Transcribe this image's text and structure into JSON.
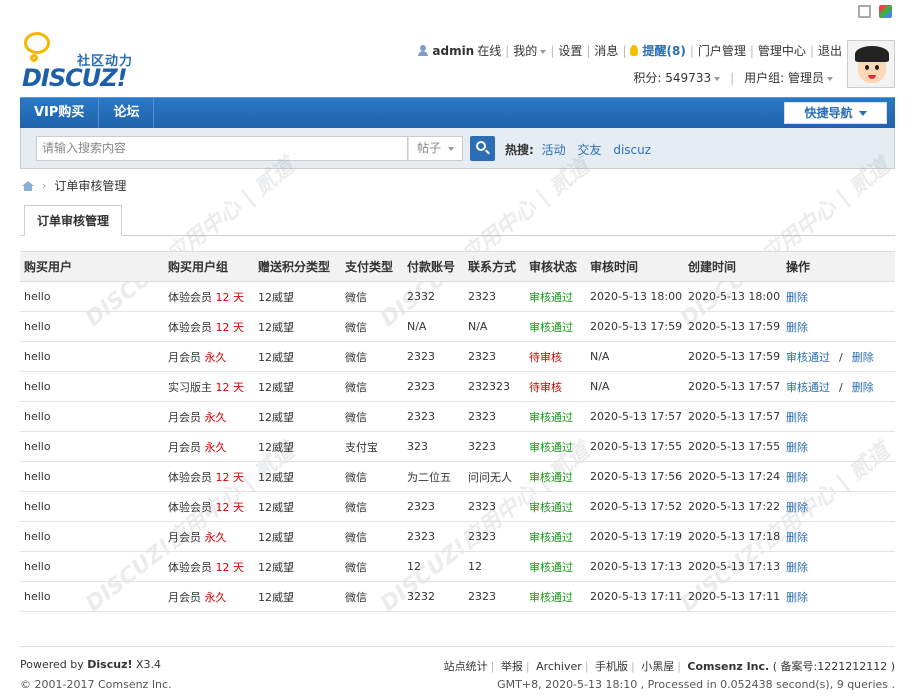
{
  "user": {
    "name": "admin",
    "status": "在线",
    "my_label": "我的",
    "settings": "设置",
    "messages": "消息",
    "remind": "提醒(8)",
    "portal_admin": "门户管理",
    "admin_center": "管理中心",
    "logout": "退出",
    "points": "积分: 549733",
    "group": "用户组: 管理员"
  },
  "logo": {
    "cn": "社区动力",
    "en": "DISCUZ!"
  },
  "nav": {
    "items": [
      "VIP购买",
      "论坛"
    ],
    "quick_nav": "快捷导航"
  },
  "search": {
    "placeholder": "请输入搜索内容",
    "type": "帖子",
    "hot_label": "热搜:",
    "hot_words": [
      "活动",
      "交友",
      "discuz"
    ]
  },
  "breadcrumb": {
    "current": "订单审核管理"
  },
  "tab": {
    "label": "订单审核管理"
  },
  "table": {
    "headers": [
      "购买用户",
      "购买用户组",
      "赠送积分类型",
      "支付类型",
      "付款账号",
      "联系方式",
      "审核状态",
      "审核时间",
      "创建时间",
      "操作"
    ],
    "rows": [
      {
        "user": "hello",
        "group": "体验会员",
        "duration": "12 天",
        "points_type": "12威望",
        "pay": "微信",
        "account": "2332",
        "contact": "2323",
        "status": "审核通过",
        "status_kind": "passed",
        "audit_time": "2020-5-13 18:00",
        "create_time": "2020-5-13 18:00",
        "ops": [
          "删除"
        ]
      },
      {
        "user": "hello",
        "group": "体验会员",
        "duration": "12 天",
        "points_type": "12威望",
        "pay": "微信",
        "account": "N/A",
        "contact": "N/A",
        "status": "审核通过",
        "status_kind": "passed",
        "audit_time": "2020-5-13 17:59",
        "create_time": "2020-5-13 17:59",
        "ops": [
          "删除"
        ]
      },
      {
        "user": "hello",
        "group": "月会员",
        "duration": "永久",
        "points_type": "12威望",
        "pay": "微信",
        "account": "2323",
        "contact": "2323",
        "status": "待审核",
        "status_kind": "pending",
        "audit_time": "N/A",
        "create_time": "2020-5-13 17:59",
        "ops": [
          "审核通过",
          "删除"
        ]
      },
      {
        "user": "hello",
        "group": "实习版主",
        "duration": "12 天",
        "points_type": "12威望",
        "pay": "微信",
        "account": "2323",
        "contact": "232323",
        "status": "待审核",
        "status_kind": "pending",
        "audit_time": "N/A",
        "create_time": "2020-5-13 17:57",
        "ops": [
          "审核通过",
          "删除"
        ]
      },
      {
        "user": "hello",
        "group": "月会员",
        "duration": "永久",
        "points_type": "12威望",
        "pay": "微信",
        "account": "2323",
        "contact": "2323",
        "status": "审核通过",
        "status_kind": "passed",
        "audit_time": "2020-5-13 17:57",
        "create_time": "2020-5-13 17:57",
        "ops": [
          "删除"
        ]
      },
      {
        "user": "hello",
        "group": "月会员",
        "duration": "永久",
        "points_type": "12威望",
        "pay": "支付宝",
        "account": "323",
        "contact": "3223",
        "status": "审核通过",
        "status_kind": "passed",
        "audit_time": "2020-5-13 17:55",
        "create_time": "2020-5-13 17:55",
        "ops": [
          "删除"
        ]
      },
      {
        "user": "hello",
        "group": "体验会员",
        "duration": "12 天",
        "points_type": "12威望",
        "pay": "微信",
        "account": "为二位五",
        "contact": "问问无人",
        "status": "审核通过",
        "status_kind": "passed",
        "audit_time": "2020-5-13 17:56",
        "create_time": "2020-5-13 17:24",
        "ops": [
          "删除"
        ]
      },
      {
        "user": "hello",
        "group": "体验会员",
        "duration": "12 天",
        "points_type": "12威望",
        "pay": "微信",
        "account": "2323",
        "contact": "2323",
        "status": "审核通过",
        "status_kind": "passed",
        "audit_time": "2020-5-13 17:52",
        "create_time": "2020-5-13 17:22",
        "ops": [
          "删除"
        ]
      },
      {
        "user": "hello",
        "group": "月会员",
        "duration": "永久",
        "points_type": "12威望",
        "pay": "微信",
        "account": "2323",
        "contact": "2323",
        "status": "审核通过",
        "status_kind": "passed",
        "audit_time": "2020-5-13 17:19",
        "create_time": "2020-5-13 17:18",
        "ops": [
          "删除"
        ]
      },
      {
        "user": "hello",
        "group": "体验会员",
        "duration": "12 天",
        "points_type": "12威望",
        "pay": "微信",
        "account": "12",
        "contact": "12",
        "status": "审核通过",
        "status_kind": "passed",
        "audit_time": "2020-5-13 17:13",
        "create_time": "2020-5-13 17:13",
        "ops": [
          "删除"
        ]
      },
      {
        "user": "hello",
        "group": "月会员",
        "duration": "永久",
        "points_type": "12威望",
        "pay": "微信",
        "account": "3232",
        "contact": "2323",
        "status": "审核通过",
        "status_kind": "passed",
        "audit_time": "2020-5-13 17:11",
        "create_time": "2020-5-13 17:11",
        "ops": [
          "删除"
        ]
      }
    ]
  },
  "footer": {
    "powered_by": "Powered by",
    "product": "Discuz!",
    "version": "X3.4",
    "copyright": "© 2001-2017 Comsenz Inc.",
    "links": [
      "站点统计",
      "举报",
      "Archiver",
      "手机版",
      "小黑屋"
    ],
    "company": "Comsenz Inc.",
    "icp": "( 备案号:1221212112 )",
    "stats": "GMT+8, 2020-5-13 18:10 , Processed in 0.052438 second(s), 9 queries ."
  },
  "watermark": {
    "text": "DISCUZ!应用中心 | 贰道",
    "sub": "addon.dismall.com"
  },
  "colors": {
    "nav_blue": "#1f63ac",
    "link_blue": "#2b6eb5",
    "passed_green": "#1a9a1a",
    "pending_red": "#dd0000"
  }
}
